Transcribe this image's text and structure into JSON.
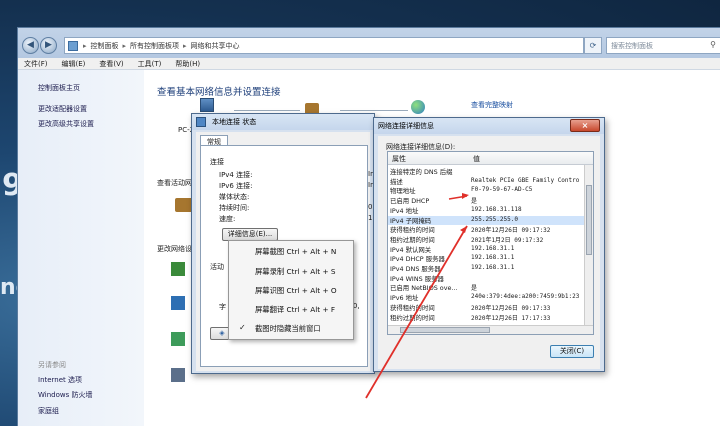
{
  "desktop": {
    "glyph1": "9",
    "glyph2": "ne"
  },
  "explorer": {
    "breadcrumb": [
      "控制面板",
      "所有控制面板项",
      "网络和共享中心"
    ],
    "search_placeholder": "搜索控制面板",
    "menu": [
      "文件(F)",
      "编辑(E)",
      "查看(V)",
      "工具(T)",
      "帮助(H)"
    ],
    "left_links": [
      "控制面板主页",
      "更改适配器设置",
      "更改高级共享设置"
    ],
    "see_also_title": "另请参阅",
    "see_also": [
      "Internet 选项",
      "Windows 防火墙",
      "家庭组"
    ],
    "heading": "查看基本网络信息并设置连接",
    "map_link": "查看完整映射",
    "pc_label": "PC-2",
    "active_label": "查看活动网",
    "change_label": "更改网络设"
  },
  "status_dialog": {
    "title": "本地连接 状态",
    "tab": "常规",
    "group_connection": "连接",
    "rows": [
      {
        "label": "IPv4 连接:",
        "value": "In"
      },
      {
        "label": "IPv6 连接:",
        "value": "In"
      },
      {
        "label": "媒体状态:",
        "value": ""
      },
      {
        "label": "持续时间:",
        "value": "0"
      },
      {
        "label": "速度:",
        "value": "1"
      }
    ],
    "details_button": "详细信息(E)...",
    "group_activity": "活动",
    "sent_label": "字",
    "bytes": "210,"
  },
  "context_menu": {
    "items": [
      {
        "label": "屏幕截图 Ctrl + Alt + N",
        "checked": false
      },
      {
        "label": "屏幕录制 Ctrl + Alt + S",
        "checked": false
      },
      {
        "label": "屏幕识图 Ctrl + Alt + O",
        "checked": false
      },
      {
        "label": "屏幕翻译 Ctrl + Alt + F",
        "checked": false
      },
      {
        "label": "截图时隐藏当前窗口",
        "checked": true
      }
    ]
  },
  "details_dialog": {
    "title": "网络连接详细信息",
    "section": "网络连接详细信息(D):",
    "col_property": "属性",
    "col_value": "值",
    "rows": [
      {
        "k": "连接特定的 DNS 后缀",
        "v": ""
      },
      {
        "k": "描述",
        "v": "Realtek PCIe GBE Family Contro"
      },
      {
        "k": "物理地址",
        "v": "F0-79-59-67-AD-C5"
      },
      {
        "k": "已启用 DHCP",
        "v": "是"
      },
      {
        "k": "IPv4 地址",
        "v": "192.168.31.118"
      },
      {
        "k": "IPv4 子网掩码",
        "v": "255.255.255.0"
      },
      {
        "k": "获得租约的时间",
        "v": "2020年12月26日 09:17:32"
      },
      {
        "k": "租约过期的时间",
        "v": "2021年1月2日 09:17:32"
      },
      {
        "k": "IPv4 默认网关",
        "v": "192.168.31.1"
      },
      {
        "k": "IPv4 DHCP 服务器",
        "v": "192.168.31.1"
      },
      {
        "k": "IPv4 DNS 服务器",
        "v": "192.168.31.1"
      },
      {
        "k": "IPv4 WINS 服务器",
        "v": ""
      },
      {
        "k": "已启用 NetBIOS ove...",
        "v": "是"
      },
      {
        "k": "IPv6 地址",
        "v": "240e:379:4dee:a200:7459:9b1:23"
      },
      {
        "k": "获得租约的时间",
        "v": "2020年12月26日 09:17:33"
      },
      {
        "k": "租约过期的时间",
        "v": "2020年12月26日 17:17:33"
      }
    ],
    "close_button": "关闭(C)"
  },
  "colors": {
    "arrow": "#e0302a",
    "accent": "#1e3f7a"
  }
}
